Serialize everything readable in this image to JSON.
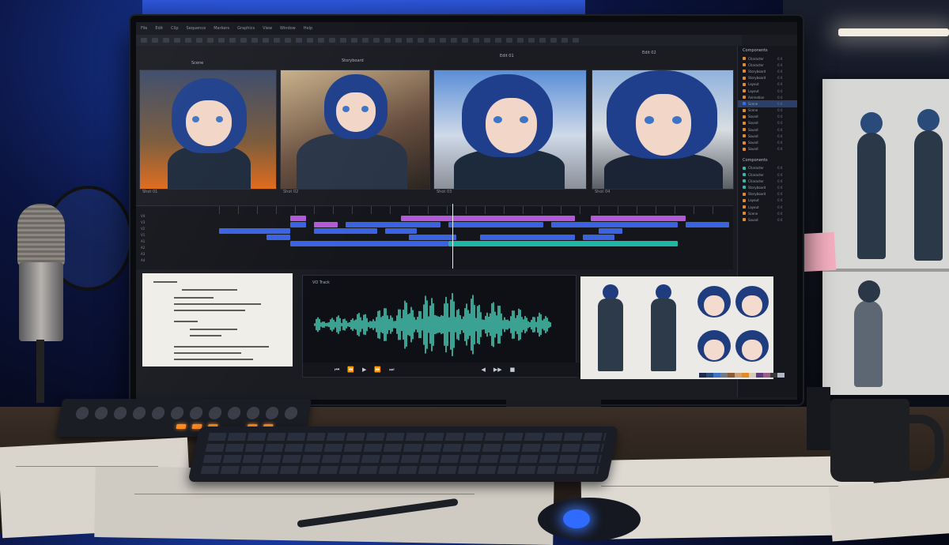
{
  "app": {
    "menu": [
      "File",
      "Edit",
      "Clip",
      "Sequence",
      "Markers",
      "Graphics",
      "View",
      "Window",
      "Help"
    ]
  },
  "viewer": {
    "frames": [
      {
        "caption": "Shot 01"
      },
      {
        "caption": "Shot 02"
      },
      {
        "caption": "Shot 03"
      },
      {
        "caption": "Shot 04"
      }
    ],
    "panel_labels": [
      "Scene",
      "Storyboard",
      "Edit 01",
      "Edit 02"
    ]
  },
  "project_panel": {
    "header_1": "Components",
    "items_1": [
      {
        "name": "Character",
        "num": "0:4",
        "color": "#e08a2a"
      },
      {
        "name": "Character",
        "num": "0:4",
        "color": "#e08a2a"
      },
      {
        "name": "Storyboard",
        "num": "0:4",
        "color": "#e08a2a"
      },
      {
        "name": "Storyboard",
        "num": "0:4",
        "color": "#e08a2a"
      },
      {
        "name": "Layout",
        "num": "0:4",
        "color": "#e08a2a"
      },
      {
        "name": "Layout",
        "num": "0:4",
        "color": "#e08a2a"
      },
      {
        "name": "Animation",
        "num": "0:4",
        "color": "#e08a2a"
      },
      {
        "name": "Scene",
        "num": "0:4",
        "color": "#3a6ee6",
        "selected": true
      },
      {
        "name": "Scene",
        "num": "0:4",
        "color": "#e08a2a"
      },
      {
        "name": "Sound",
        "num": "0:4",
        "color": "#e08a2a"
      },
      {
        "name": "Sound",
        "num": "0:4",
        "color": "#e08a2a"
      },
      {
        "name": "Sound",
        "num": "0:4",
        "color": "#e08a2a"
      },
      {
        "name": "Sound",
        "num": "0:4",
        "color": "#e08a2a"
      },
      {
        "name": "Sound",
        "num": "0:4",
        "color": "#e08a2a"
      },
      {
        "name": "Sound",
        "num": "0:4",
        "color": "#e08a2a"
      }
    ],
    "header_2": "Components",
    "items_2": [
      {
        "name": "Character",
        "num": "0:4",
        "color": "#2fb8a8"
      },
      {
        "name": "Character",
        "num": "0:4",
        "color": "#2fb8a8"
      },
      {
        "name": "Character",
        "num": "0:4",
        "color": "#2fb8a8"
      },
      {
        "name": "Storyboard",
        "num": "0:4",
        "color": "#2fb8a8"
      },
      {
        "name": "Storyboard",
        "num": "0:4",
        "color": "#e08a2a"
      },
      {
        "name": "Layout",
        "num": "0:4",
        "color": "#e08a2a"
      },
      {
        "name": "Layout",
        "num": "0:4",
        "color": "#e08a2a"
      },
      {
        "name": "Scene",
        "num": "0:4",
        "color": "#e08a2a"
      },
      {
        "name": "Sound",
        "num": "0:4",
        "color": "#e08a2a"
      }
    ]
  },
  "timeline": {
    "track_labels": [
      "V4",
      "V3",
      "V2",
      "V1",
      "A1",
      "A2",
      "A3",
      "A4"
    ],
    "colors": {
      "video": "#3b63e0",
      "overlay": "#b259d8",
      "audio": "#1fb6a6"
    }
  },
  "script": {
    "lines": [
      "INT. CITY RUINS - NIGHT",
      "KIRA",
      "We have to move. Now.",
      "EXT. ROOFTOP - DAWN"
    ]
  },
  "audio": {
    "panel_title": "VO Track",
    "transport": [
      "⏮",
      "⏪",
      "▶",
      "⏩",
      "⏭"
    ],
    "transport_right": [
      "◀",
      "▶▶",
      "■"
    ]
  },
  "character_sheet": {
    "palette": [
      "#1d2b4a",
      "#2a4a7a",
      "#3d74c6",
      "#6f7a8a",
      "#8b5c3a",
      "#c9a27a",
      "#e08a2a",
      "#d8c9b8",
      "#5a3f7a",
      "#a05a8a",
      "#3a3a3a",
      "#b0b8c8"
    ]
  }
}
